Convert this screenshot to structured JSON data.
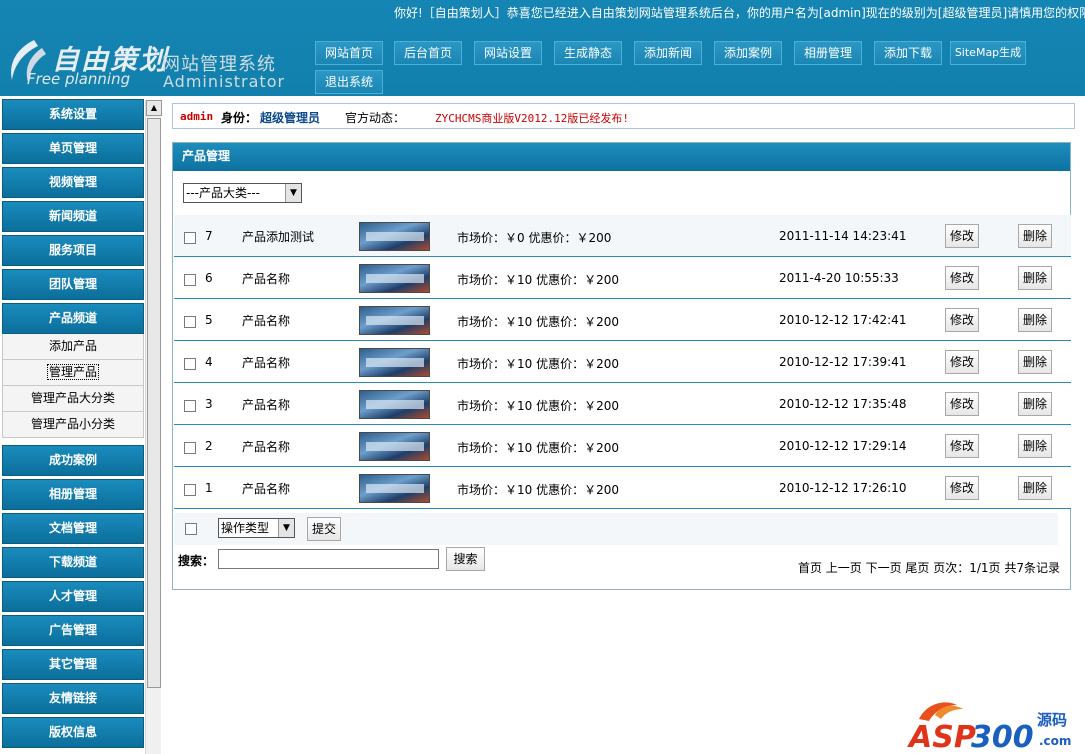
{
  "header": {
    "welcome": "你好!［自由策划人］恭喜您已经进入自由策划网站管理系统后台，你的用户名为[admin]现在的级别为[超级管理员]请慎用您的权限",
    "logo_script": "自由策划",
    "logo_free": "Free planning",
    "logo_cn": "网站管理系统",
    "logo_en": "Administrator",
    "nav": [
      "网站首页",
      "后台首页",
      "网站设置",
      "生成静态",
      "添加新闻",
      "添加案例",
      "相册管理",
      "添加下载",
      "SiteMap生成",
      "退出系统"
    ]
  },
  "sidebar": {
    "heads_top": [
      "系统设置",
      "单页管理",
      "视频管理",
      "新闻频道",
      "服务项目",
      "团队管理",
      "产品频道"
    ],
    "subs": [
      "添加产品",
      "管理产品",
      "管理产品大分类",
      "管理产品小分类"
    ],
    "heads_bottom": [
      "成功案例",
      "相册管理",
      "文档管理",
      "下载频道",
      "人才管理",
      "广告管理",
      "其它管理",
      "友情链接",
      "版权信息"
    ]
  },
  "status": {
    "user": "admin",
    "role_label": "身份：",
    "role": "超级管理员",
    "news_label": "官方动态：",
    "news": "ZYCHCMS商业版V2012.12版已经发布!"
  },
  "panel": {
    "title": "产品管理",
    "category_select": "---产品大类---",
    "edit_label": "修改",
    "delete_label": "删除",
    "rows": [
      {
        "id": "7",
        "name": "产品添加测试",
        "price": "市场价：￥0 优惠价：￥200",
        "time": "2011-11-14 14:23:41"
      },
      {
        "id": "6",
        "name": "产品名称",
        "price": "市场价：￥10 优惠价：￥200",
        "time": "2011-4-20 10:55:33"
      },
      {
        "id": "5",
        "name": "产品名称",
        "price": "市场价：￥10 优惠价：￥200",
        "time": "2010-12-12 17:42:41"
      },
      {
        "id": "4",
        "name": "产品名称",
        "price": "市场价：￥10 优惠价：￥200",
        "time": "2010-12-12 17:39:41"
      },
      {
        "id": "3",
        "name": "产品名称",
        "price": "市场价：￥10 优惠价：￥200",
        "time": "2010-12-12 17:35:48"
      },
      {
        "id": "2",
        "name": "产品名称",
        "price": "市场价：￥10 优惠价：￥200",
        "time": "2010-12-12 17:29:14"
      },
      {
        "id": "1",
        "name": "产品名称",
        "price": "市场价：￥10 优惠价：￥200",
        "time": "2010-12-12 17:26:10"
      }
    ],
    "op_select": "操作类型",
    "submit_label": "提交",
    "search_label": "搜索：",
    "search_button": "搜索",
    "search_value": "",
    "pager": "首页  上一页  下一页  尾页  页次：1/1页  共7条记录"
  },
  "watermark": {
    "brand": "ASP300",
    "suffix": "源码",
    "domain": ".com"
  },
  "colors": {
    "header_bg": "#1585b4",
    "sidebar_head": "#0b6f9c",
    "news_red": "#cc0000",
    "role_blue": "#0b4a8a",
    "row_border": "#2b8ab6"
  }
}
